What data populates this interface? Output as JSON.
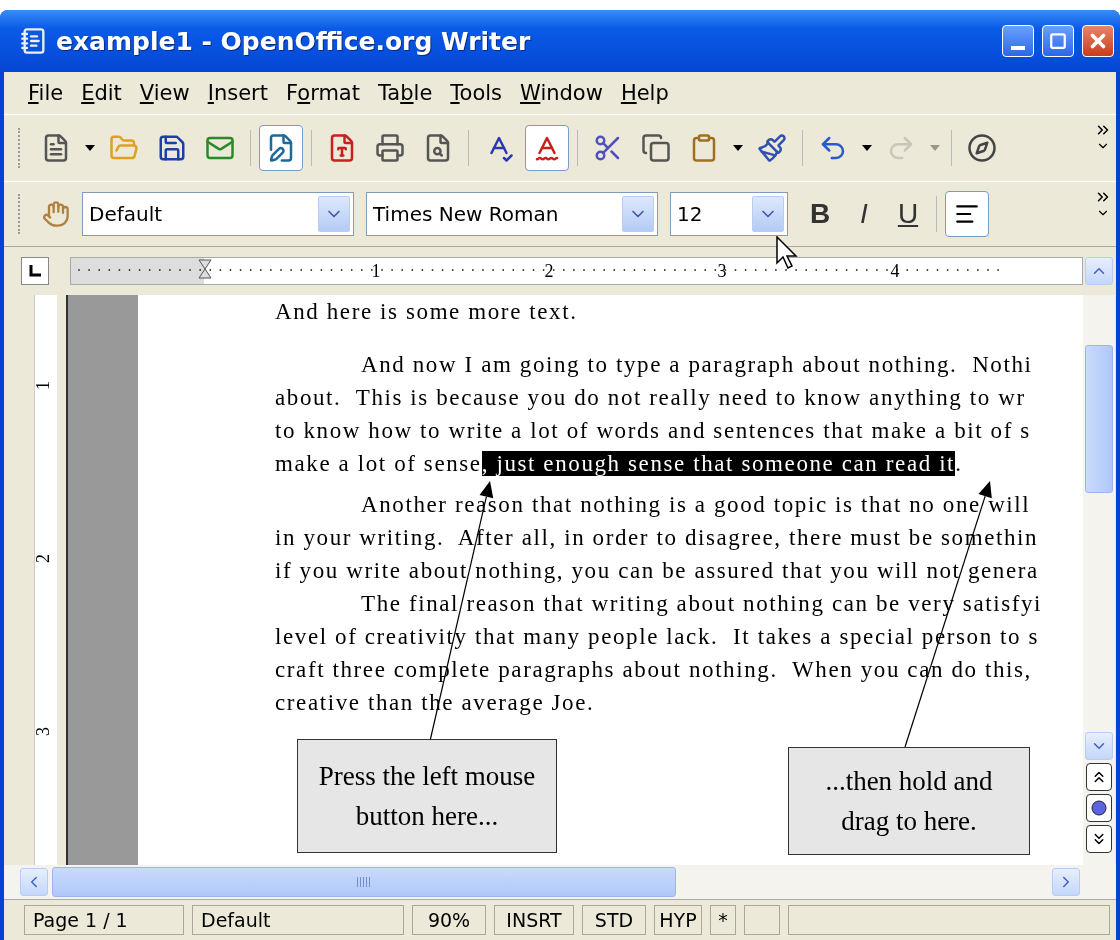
{
  "window": {
    "title": "example1 - OpenOffice.org Writer"
  },
  "menu": [
    {
      "key": "F",
      "post": "ile"
    },
    {
      "key": "E",
      "post": "dit"
    },
    {
      "key": "V",
      "post": "iew"
    },
    {
      "key": "I",
      "post": "nsert"
    },
    {
      "pre": "F",
      "key": "o",
      "post": "rmat"
    },
    {
      "pre": "Ta",
      "key": "b",
      "post": "le"
    },
    {
      "key": "T",
      "post": "ools"
    },
    {
      "key": "W",
      "post": "indow"
    },
    {
      "key": "H",
      "post": "elp"
    }
  ],
  "standard_toolbar": [
    {
      "kind": "button",
      "pressed": false,
      "disabled": false,
      "dropdown": true
    },
    {
      "kind": "button",
      "pressed": false,
      "disabled": false,
      "dropdown": false
    },
    {
      "kind": "button",
      "pressed": false,
      "disabled": false,
      "dropdown": false
    },
    {
      "kind": "button",
      "pressed": false,
      "disabled": false,
      "dropdown": false
    },
    {
      "kind": "separator"
    },
    {
      "kind": "button",
      "pressed": true,
      "disabled": false,
      "dropdown": false
    },
    {
      "kind": "separator"
    },
    {
      "kind": "button",
      "pressed": false,
      "disabled": false,
      "dropdown": false
    },
    {
      "kind": "button",
      "pressed": false,
      "disabled": false,
      "dropdown": false
    },
    {
      "kind": "button",
      "pressed": false,
      "disabled": false,
      "dropdown": false
    },
    {
      "kind": "separator"
    },
    {
      "kind": "button",
      "pressed": false,
      "disabled": false,
      "dropdown": false
    },
    {
      "kind": "button",
      "pressed": true,
      "disabled": false,
      "dropdown": false
    },
    {
      "kind": "separator"
    },
    {
      "kind": "button",
      "pressed": false,
      "disabled": false,
      "dropdown": false
    },
    {
      "kind": "button",
      "pressed": false,
      "disabled": false,
      "dropdown": false
    },
    {
      "kind": "button",
      "pressed": false,
      "disabled": false,
      "dropdown": true
    },
    {
      "kind": "button",
      "pressed": false,
      "disabled": false,
      "dropdown": false
    },
    {
      "kind": "separator"
    },
    {
      "kind": "button",
      "pressed": false,
      "disabled": false,
      "dropdown": true
    },
    {
      "kind": "button",
      "pressed": false,
      "disabled": true,
      "dropdown": true
    },
    {
      "kind": "separator"
    },
    {
      "kind": "button",
      "pressed": false,
      "disabled": false,
      "dropdown": false
    }
  ],
  "formatting_toolbar": {
    "paragraph_style": {
      "value": "Default"
    },
    "font_name": {
      "value": "Times New Roman"
    },
    "font_size": {
      "value": "12"
    },
    "styles": [
      {
        "label": "B",
        "pressed": false
      },
      {
        "label": "I",
        "pressed": false
      },
      {
        "label": "U",
        "pressed": false
      }
    ],
    "align_left": {
      "pressed": true
    }
  },
  "ruler": {
    "labels": [
      "1",
      "2",
      "3",
      "4"
    ]
  },
  "vertical_ruler": {
    "labels": [
      "1",
      "2",
      "3"
    ]
  },
  "document": {
    "lines": [
      {
        "first_line": false,
        "segments": [
          {
            "text": "And here is some more text.",
            "selected": false
          }
        ]
      },
      {
        "first_line": true,
        "segments": [
          {
            "text": "And now I am going to type a paragraph about nothing.  Nothi",
            "selected": false
          }
        ]
      },
      {
        "first_line": false,
        "segments": [
          {
            "text": "about.  This is because you do not really need to know anything to wr",
            "selected": false
          }
        ]
      },
      {
        "first_line": false,
        "segments": [
          {
            "text": "to know how to write a lot of words and sentences that make a bit of s",
            "selected": false
          }
        ]
      },
      {
        "first_line": false,
        "segments": [
          {
            "text": "make a lot of sense",
            "selected": false
          },
          {
            "text": ", just enough sense that someone can read it",
            "selected": true
          },
          {
            "text": ".",
            "selected": false
          }
        ]
      },
      {
        "first_line": true,
        "segments": [
          {
            "text": "Another reason that nothing is a good topic is that no one will",
            "selected": false
          }
        ]
      },
      {
        "first_line": false,
        "segments": [
          {
            "text": "in your writing.  After all, in order to disagree, there must be somethin",
            "selected": false
          }
        ]
      },
      {
        "first_line": false,
        "segments": [
          {
            "text": "if you write about nothing, you can be assured that you will not genera",
            "selected": false
          }
        ]
      },
      {
        "first_line": true,
        "segments": [
          {
            "text": "The final reason that writing about nothing can be very satisfyi",
            "selected": false
          }
        ]
      },
      {
        "first_line": false,
        "segments": [
          {
            "text": "level of creativity that many people lack.  It takes a special person to s",
            "selected": false
          }
        ]
      },
      {
        "first_line": false,
        "segments": [
          {
            "text": "craft three complete paragraphs about nothing.  When you can do this,",
            "selected": false
          }
        ]
      },
      {
        "first_line": false,
        "segments": [
          {
            "text": "creative than the average Joe.",
            "selected": false
          }
        ]
      }
    ],
    "callouts": [
      {
        "text": "Press the left mouse button here..."
      },
      {
        "text": "...then hold and drag to here."
      }
    ]
  },
  "status_bar": [
    "Page 1 / 1",
    "Default",
    "90%",
    "INSRT",
    "STD",
    "HYP",
    "*"
  ]
}
